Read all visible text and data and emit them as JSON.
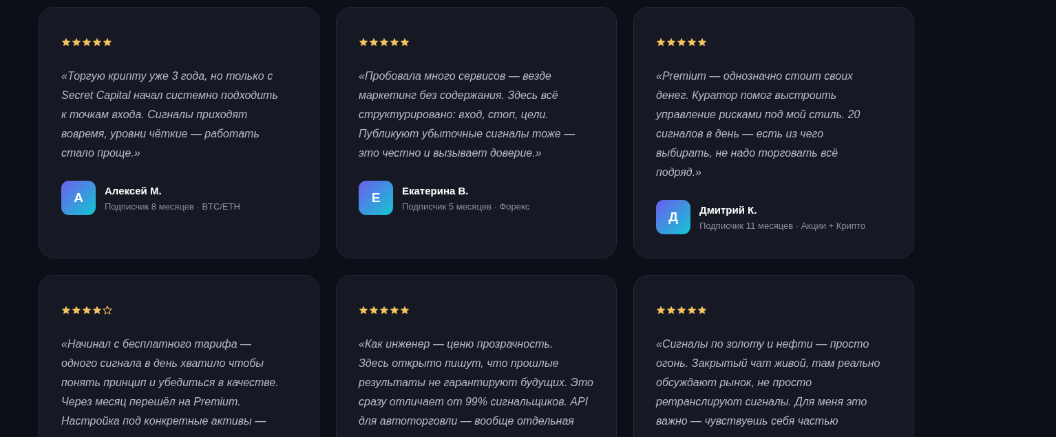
{
  "reviews": [
    {
      "stars": 5,
      "quote": "«Торгую крипту уже 3 года, но только с\nSecret Capital начал системно подходить\nк точкам входа. Сигналы приходят\nвовремя, уровни чёткие — работать\nстало проще.»",
      "initial": "А",
      "name": "Алексей М.",
      "meta": "Подписчик 8 месяцев · BTC/ETH"
    },
    {
      "stars": 5,
      "quote": "«Пробовала много сервисов — везде\nмаркетинг без содержания. Здесь всё\nструктурировано: вход, стоп, цели.\nПубликуют убыточные сигналы тоже —\nэто честно и вызывает доверие.»",
      "initial": "Е",
      "name": "Екатерина В.",
      "meta": "Подписчик 5 месяцев · Форекс"
    },
    {
      "stars": 5,
      "quote": "«Premium — однозначно стоит своих\nденег. Куратор помог выстроить\nуправление рисками под мой стиль. 20\nсигналов в день — есть из чего\nвыбирать, не надо торговать всё\nподряд.»",
      "initial": "Д",
      "name": "Дмитрий К.",
      "meta": "Подписчик 11 месяцев · Акции + Крипто"
    },
    {
      "stars": 4,
      "quote": "«Начинал с бесплатного тарифа —\nодного сигнала в день хватило чтобы\nпонять принцип и убедиться в качестве.\nЧерез месяц перешёл на Premium.\nНастройка под конкретные активы —"
    },
    {
      "stars": 5,
      "quote": "«Как инженер — ценю прозрачность.\nЗдесь открыто пишут, что прошлые\nрезультаты не гарантируют будущих. Это\nсразу отличает от 99% сигнальщиков. API\nдля автоторговли — вообще отдельная"
    },
    {
      "stars": 5,
      "quote": "«Сигналы по золоту и нефти — просто\nогонь. Закрытый чат живой, там реально\nобсуждают рынок, не просто\nретранслируют сигналы. Для меня это\nважно — чувствуешь себя частью"
    }
  ]
}
